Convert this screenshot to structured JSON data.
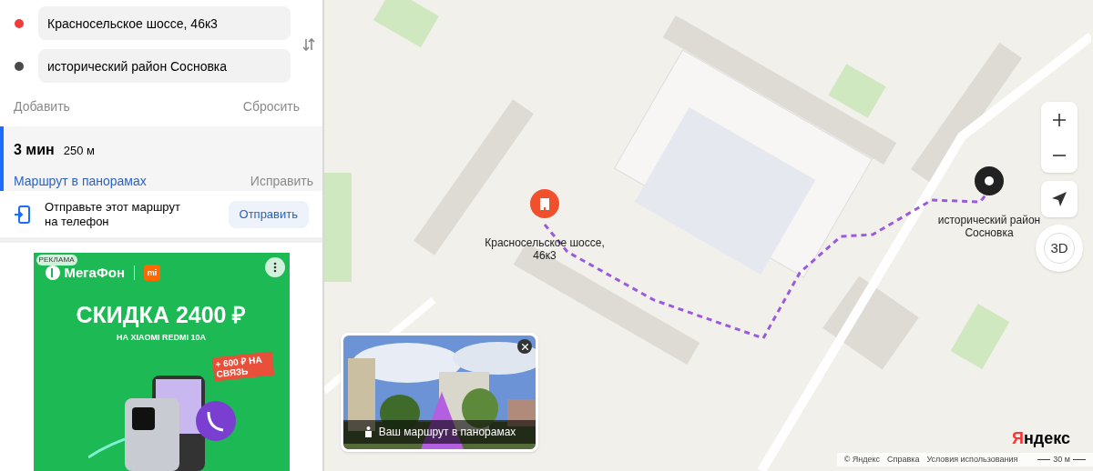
{
  "route_form": {
    "points": [
      {
        "value": "Красносельское шоссе, 46к3",
        "color": "#f03c3c"
      },
      {
        "value": "исторический район Сосновка",
        "color": "#4a4a4a"
      }
    ],
    "add": "Добавить",
    "reset": "Сбросить"
  },
  "route": {
    "selected": true,
    "time": "3 мин",
    "distance": "250 м",
    "panorama_link": "Маршрут в панорамах",
    "edit": "Исправить"
  },
  "send": {
    "text": "Отправьте этот маршрут на телефон",
    "button": "Отправить"
  },
  "ad": {
    "badge": "РЕКЛАМА",
    "brand": "МегаФон",
    "partner": "mi",
    "headline": "СКИДКА 2400 ₽",
    "subline": "НА XIAOMI REDMI 10A",
    "sticker": "+ 600 ₽ НА СВЯЗЬ"
  },
  "map": {
    "markers": [
      {
        "kind": "start",
        "label": "Красносельское шоссе, 46к3"
      },
      {
        "kind": "end",
        "label": "исторический район Сосновка"
      }
    ],
    "three_d": "3D",
    "panorama_card": {
      "caption": "Ваш маршрут в панорамах"
    },
    "logo": "Яндекс",
    "footer_links": [
      "© Яндекс",
      "Справка",
      "Условия использования"
    ],
    "scale": "30 м"
  }
}
